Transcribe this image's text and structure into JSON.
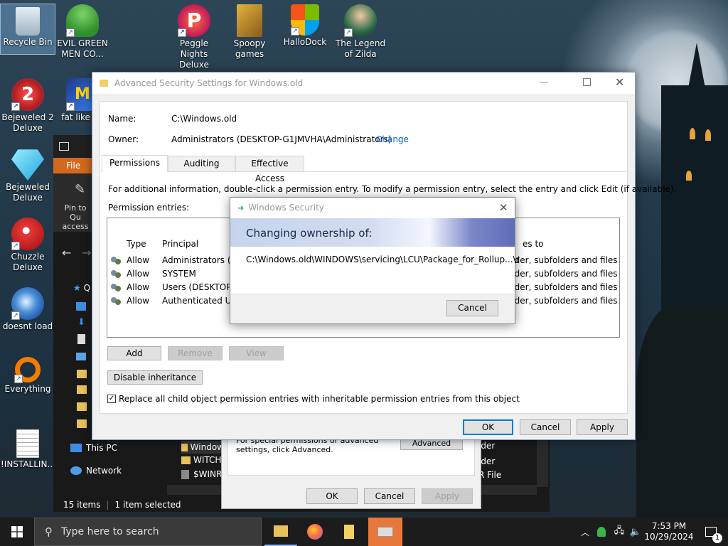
{
  "desktop": {
    "icons": [
      {
        "label": "Recycle Bin"
      },
      {
        "label": "EVIL GREEN MEN CO..."
      },
      {
        "label": "Peggle Nights Deluxe"
      },
      {
        "label": "Spoopy games"
      },
      {
        "label": "HalloDock"
      },
      {
        "label": "The Legend of Zilda"
      },
      {
        "label": "Bejeweled 2 Deluxe"
      },
      {
        "label": "fat like da"
      },
      {
        "label": "Bejeweled Deluxe"
      },
      {
        "label": "Chuzzle Deluxe"
      },
      {
        "label": "doesnt load"
      },
      {
        "label": "Everything"
      },
      {
        "label": "!INSTALLIN..."
      }
    ]
  },
  "explorer": {
    "file_tab": "File",
    "pin_label": "Pin to Qu access",
    "nav_q": "Q",
    "this_pc": "This PC",
    "network": "Network",
    "files": [
      "Window",
      "WITCH",
      "$WINR"
    ],
    "right_frag": [
      "lder",
      "lder",
      "R File"
    ],
    "status_items": "15 items",
    "status_selected": "1 item selected"
  },
  "properties": {
    "advanced_text": "For special permissions or advanced settings, click Advanced.",
    "advanced_button": "Advanced",
    "ok": "OK",
    "cancel": "Cancel",
    "apply": "Apply"
  },
  "advanced": {
    "title": "Advanced Security Settings for Windows.old",
    "name_label": "Name:",
    "name_value": "C:\\Windows.old",
    "owner_label": "Owner:",
    "owner_value": "Administrators (DESKTOP-G1JMVHA\\Administrators)",
    "change_link": "Change",
    "tabs": [
      "Permissions",
      "Auditing",
      "Effective Access"
    ],
    "info": "For additional information, double-click a permission entry. To modify a permission entry, select the entry and click Edit (if available).",
    "entries_label": "Permission entries:",
    "col_type": "Type",
    "col_principal": "Principal",
    "col_applies": "es to",
    "rows": [
      {
        "type": "Allow",
        "principal": "Administrators (DE",
        "applies": "older, subfolders and files"
      },
      {
        "type": "Allow",
        "principal": "SYSTEM",
        "applies": "older, subfolders and files"
      },
      {
        "type": "Allow",
        "principal": "Users (DESKTOP-G",
        "applies": "older, subfolders and files"
      },
      {
        "type": "Allow",
        "principal": "Authenticated Use",
        "applies": "older, subfolders and files"
      }
    ],
    "add": "Add",
    "remove": "Remove",
    "view": "View",
    "disable_inheritance": "Disable inheritance",
    "replace_checkbox": "Replace all child object permission entries with inheritable permission entries from this object",
    "replace_checked": true,
    "ok": "OK",
    "cancel": "Cancel",
    "apply": "Apply"
  },
  "security": {
    "title": "Windows Security",
    "heading": "Changing ownership of:",
    "path": "C:\\Windows.old\\WINDOWS\\servicing\\LCU\\Package_for_Rollup...\\r",
    "cancel": "Cancel"
  },
  "taskbar": {
    "search_placeholder": "Type here to search",
    "time": "7:53 PM",
    "date": "10/29/2024",
    "notification_count": "1"
  },
  "colors": {
    "accent": "#0078d7",
    "explorer_orange": "#d2691e",
    "link": "#0066cc"
  }
}
